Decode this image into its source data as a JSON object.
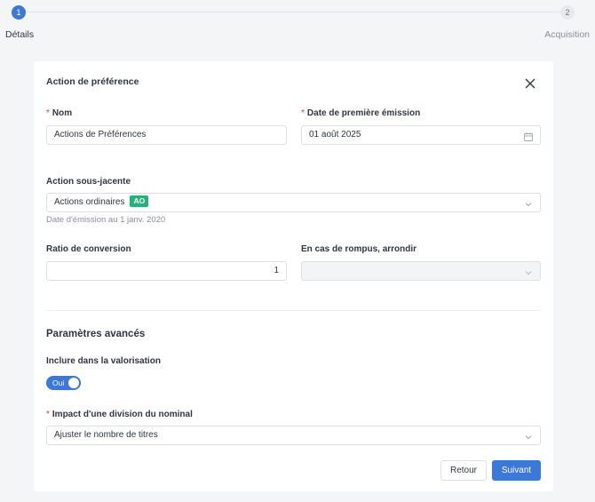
{
  "stepper": {
    "steps": [
      {
        "number": "1",
        "label": "Détails"
      },
      {
        "number": "2",
        "label": "Acquisition"
      }
    ]
  },
  "form": {
    "title": "Action de préférence",
    "nom": {
      "label": "Nom",
      "value": "Actions de Préférences"
    },
    "date_emission": {
      "label": "Date de première émission",
      "value": "01 août 2025"
    },
    "action_sous_jacente": {
      "label": "Action sous-jacente",
      "value": "Actions ordinaires",
      "badge": "AO",
      "hint": "Date d'émission au 1 janv. 2020"
    },
    "ratio": {
      "label": "Ratio de conversion",
      "value": "1"
    },
    "rompus": {
      "label": "En cas de rompus, arrondir",
      "value": ""
    },
    "advanced_title": "Paramètres avancés",
    "valorisation": {
      "label": "Inclure dans la valorisation",
      "toggle_text": "Oui"
    },
    "impact": {
      "label": "Impact d'une division du nominal",
      "value": "Ajuster le nombre de titres"
    },
    "buttons": {
      "back": "Retour",
      "next": "Suivant"
    }
  },
  "colors": {
    "primary": "#3c78d8",
    "badge": "#23b37a",
    "required": "#e03b3b"
  }
}
